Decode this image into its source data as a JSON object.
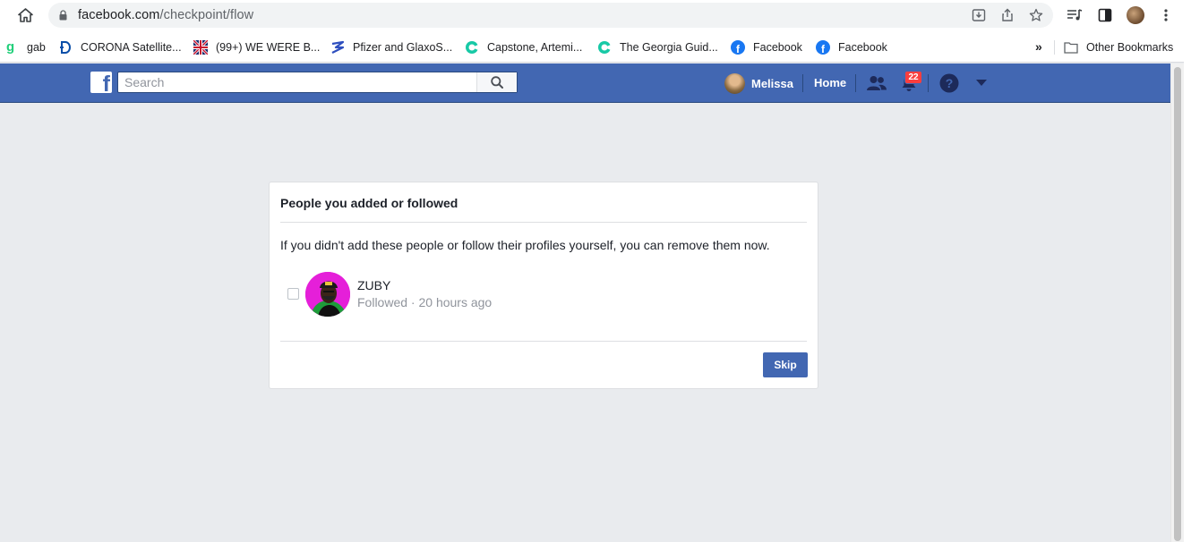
{
  "browser": {
    "url_host": "facebook.com",
    "url_path": "/checkpoint/flow",
    "bookmarks": [
      {
        "label": "gab",
        "icon": "gab-icon"
      },
      {
        "label": "CORONA Satellite...",
        "icon": "corona-icon"
      },
      {
        "label": "(99+) WE WERE B...",
        "icon": "flag-icon"
      },
      {
        "label": "Pfizer and GlaxoS...",
        "icon": "pfizer-icon"
      },
      {
        "label": "Capstone, Artemi...",
        "icon": "capstone-icon"
      },
      {
        "label": "The Georgia Guid...",
        "icon": "georgia-icon"
      },
      {
        "label": "Facebook",
        "icon": "facebook-icon"
      },
      {
        "label": "Facebook",
        "icon": "facebook-icon"
      }
    ],
    "more_bookmarks": "»",
    "other_bookmarks": "Other Bookmarks"
  },
  "fb_header": {
    "search_placeholder": "Search",
    "user_name": "Melissa",
    "home_label": "Home",
    "notification_count": "22",
    "logo_letter": "f"
  },
  "dialog": {
    "title": "People you added or followed",
    "description": "If you didn't add these people or follow their profiles yourself, you can remove them now.",
    "people": [
      {
        "name": "ZUBY",
        "status": "Followed",
        "separator": "·",
        "time": "20 hours ago"
      }
    ],
    "skip_label": "Skip"
  },
  "colors": {
    "fb_blue": "#4267b2",
    "page_bg": "#e9ebee",
    "badge_red": "#fa3e3e"
  }
}
